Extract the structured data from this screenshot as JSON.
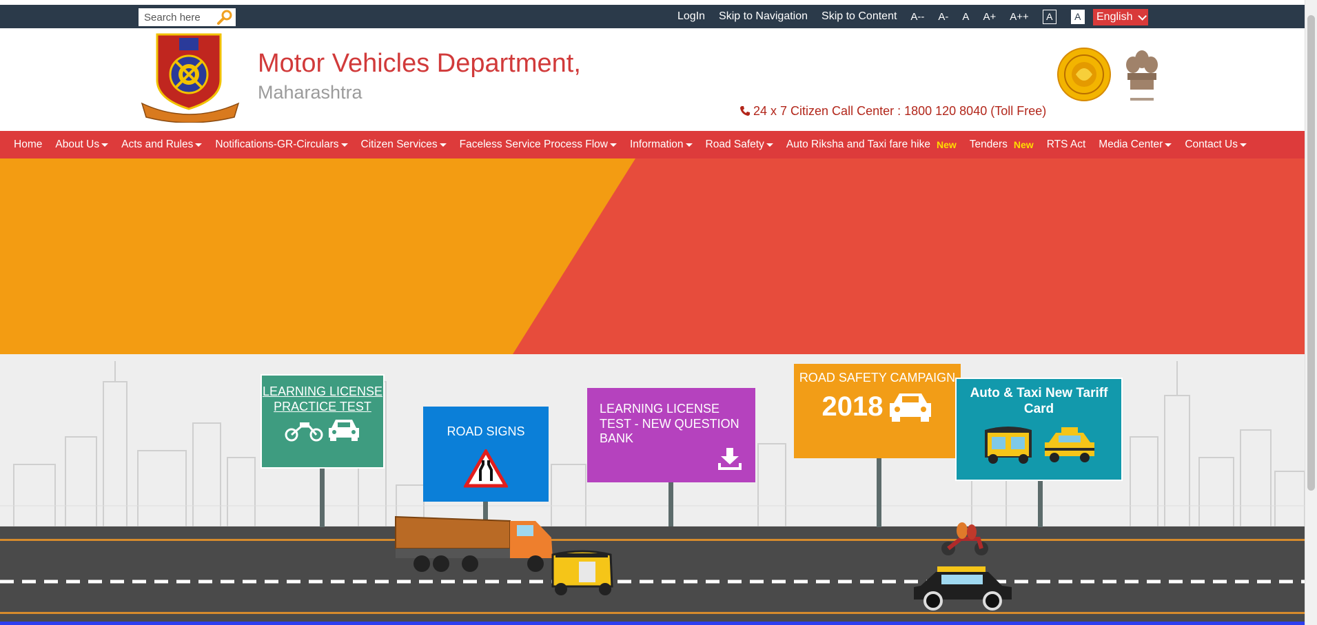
{
  "topbar": {
    "search_placeholder": "Search here",
    "links": [
      "LogIn",
      "Skip to Navigation",
      "Skip to Content"
    ],
    "font_sizes": [
      "A--",
      "A-",
      "A",
      "A+",
      "A++"
    ],
    "contrast": [
      "A",
      "A"
    ],
    "language": "English"
  },
  "header": {
    "title": "Motor Vehicles Department,",
    "subtitle": "Maharashtra",
    "call_center": "24 x 7 Citizen Call Center : 1800 120 8040 (Toll Free)"
  },
  "nav": [
    {
      "label": "Home",
      "dropdown": false
    },
    {
      "label": "About Us",
      "dropdown": true
    },
    {
      "label": "Acts and Rules",
      "dropdown": true
    },
    {
      "label": "Notifications-GR-Circulars",
      "dropdown": true
    },
    {
      "label": "Citizen Services",
      "dropdown": true
    },
    {
      "label": "Faceless Service Process Flow",
      "dropdown": true
    },
    {
      "label": "Information",
      "dropdown": true
    },
    {
      "label": "Road Safety",
      "dropdown": true
    },
    {
      "label": "Auto Riksha and Taxi fare hike",
      "dropdown": false,
      "badge": "New"
    },
    {
      "label": "Tenders",
      "dropdown": false,
      "badge": "New"
    },
    {
      "label": "RTS Act",
      "dropdown": false
    },
    {
      "label": "Media Center",
      "dropdown": true
    },
    {
      "label": "Contact Us",
      "dropdown": true
    }
  ],
  "boards": {
    "practice_test": "LEARNING LICENSE PRACTICE TEST",
    "road_signs": "ROAD SIGNS",
    "question_bank": "LEARNING LICENSE TEST - NEW QUESTION BANK",
    "road_safety": "ROAD SAFETY CAMPAIGN",
    "road_safety_year": "2018",
    "tariff_card": "Auto & Taxi New Tariff Card"
  },
  "colors": {
    "topbar": "#2b3a4a",
    "nav": "#dd3b3b",
    "title": "#d13a3a",
    "hero_orange": "#f39c12",
    "hero_red": "#e74c3c",
    "new_badge": "#ffdd00"
  }
}
